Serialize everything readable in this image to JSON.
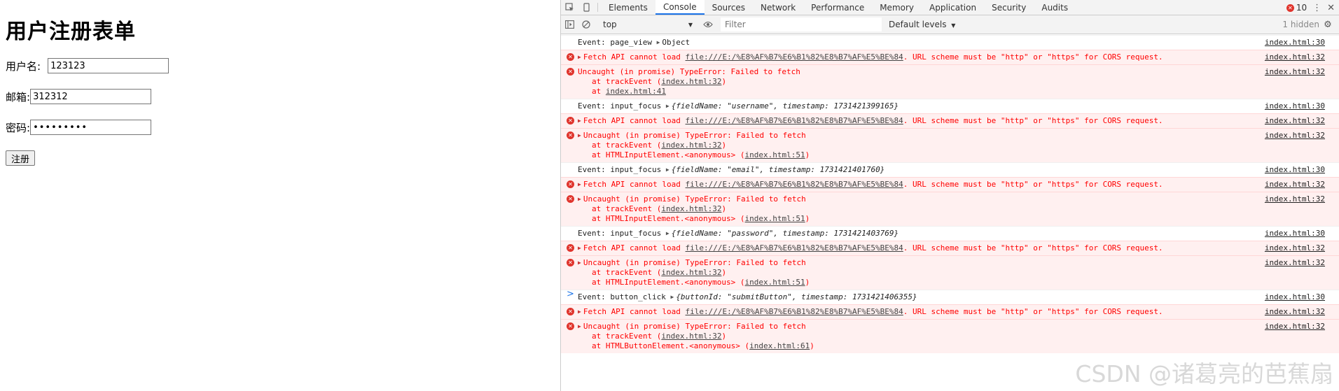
{
  "page": {
    "title": "用户注册表单",
    "username_label": "用户名:",
    "username_value": "123123",
    "email_label": "邮箱:",
    "email_value": "312312",
    "password_label": "密码:",
    "password_value": "•••••••••",
    "submit_label": "注册"
  },
  "devtools": {
    "tabs": [
      "Elements",
      "Console",
      "Sources",
      "Network",
      "Performance",
      "Memory",
      "Application",
      "Security",
      "Audits"
    ],
    "active_tab": "Console",
    "error_count": "10",
    "context": "top",
    "filter_placeholder": "Filter",
    "levels": "Default levels",
    "hidden": "1 hidden",
    "messages": [
      {
        "type": "log",
        "text": "Event: page_view ",
        "obj": "Object",
        "src": "index.html:30"
      },
      {
        "type": "err",
        "text": "Fetch API cannot load ",
        "link": "file:///E:/%E8%AF%B7%E6%B1%82%E8%B7%AF%E5%BE%84",
        "rest": ". URL scheme must be \"http\" or \"https\" for CORS request.",
        "src": "index.html:32"
      },
      {
        "type": "err",
        "text": "Uncaught (in promise) TypeError: Failed to fetch",
        "stack": [
          [
            "at trackEvent (",
            "index.html:32",
            ")"
          ],
          [
            "at ",
            "index.html:41",
            ""
          ]
        ],
        "src": "index.html:32",
        "noTri": true
      },
      {
        "type": "log",
        "text": "Event: input_focus ",
        "obj": "{fieldName: \"username\", timestamp: 1731421399165}",
        "src": "index.html:30"
      },
      {
        "type": "err",
        "text": "Fetch API cannot load ",
        "link": "file:///E:/%E8%AF%B7%E6%B1%82%E8%B7%AF%E5%BE%84",
        "rest": ". URL scheme must be \"http\" or \"https\" for CORS request.",
        "src": "index.html:32"
      },
      {
        "type": "err",
        "text": "Uncaught (in promise) TypeError: Failed to fetch",
        "stack": [
          [
            "at trackEvent (",
            "index.html:32",
            ")"
          ],
          [
            "at HTMLInputElement.<anonymous> (",
            "index.html:51",
            ")"
          ]
        ],
        "src": "index.html:32"
      },
      {
        "type": "log",
        "text": "Event: input_focus ",
        "obj": "{fieldName: \"email\", timestamp: 1731421401760}",
        "src": "index.html:30"
      },
      {
        "type": "err",
        "text": "Fetch API cannot load ",
        "link": "file:///E:/%E8%AF%B7%E6%B1%82%E8%B7%AF%E5%BE%84",
        "rest": ". URL scheme must be \"http\" or \"https\" for CORS request.",
        "src": "index.html:32"
      },
      {
        "type": "err",
        "text": "Uncaught (in promise) TypeError: Failed to fetch",
        "stack": [
          [
            "at trackEvent (",
            "index.html:32",
            ")"
          ],
          [
            "at HTMLInputElement.<anonymous> (",
            "index.html:51",
            ")"
          ]
        ],
        "src": "index.html:32"
      },
      {
        "type": "log",
        "text": "Event: input_focus ",
        "obj": "{fieldName: \"password\", timestamp: 1731421403769}",
        "src": "index.html:30"
      },
      {
        "type": "err",
        "text": "Fetch API cannot load ",
        "link": "file:///E:/%E8%AF%B7%E6%B1%82%E8%B7%AF%E5%BE%84",
        "rest": ". URL scheme must be \"http\" or \"https\" for CORS request.",
        "src": "index.html:32"
      },
      {
        "type": "err",
        "text": "Uncaught (in promise) TypeError: Failed to fetch",
        "stack": [
          [
            "at trackEvent (",
            "index.html:32",
            ")"
          ],
          [
            "at HTMLInputElement.<anonymous> (",
            "index.html:51",
            ")"
          ]
        ],
        "src": "index.html:32"
      },
      {
        "type": "log",
        "text": "Event: button_click ",
        "obj": "{buttonId: \"submitButton\", timestamp: 1731421406355}",
        "src": "index.html:30"
      },
      {
        "type": "err",
        "text": "Fetch API cannot load ",
        "link": "file:///E:/%E8%AF%B7%E6%B1%82%E8%B7%AF%E5%BE%84",
        "rest": ". URL scheme must be \"http\" or \"https\" for CORS request.",
        "src": "index.html:32"
      },
      {
        "type": "err",
        "text": "Uncaught (in promise) TypeError: Failed to fetch",
        "stack": [
          [
            "at trackEvent (",
            "index.html:32",
            ")"
          ],
          [
            "at HTMLButtonElement.<anonymous> (",
            "index.html:61",
            ")"
          ]
        ],
        "src": "index.html:32"
      }
    ],
    "prompt": ">"
  },
  "watermark": "CSDN @诸葛亮的芭蕉扇"
}
